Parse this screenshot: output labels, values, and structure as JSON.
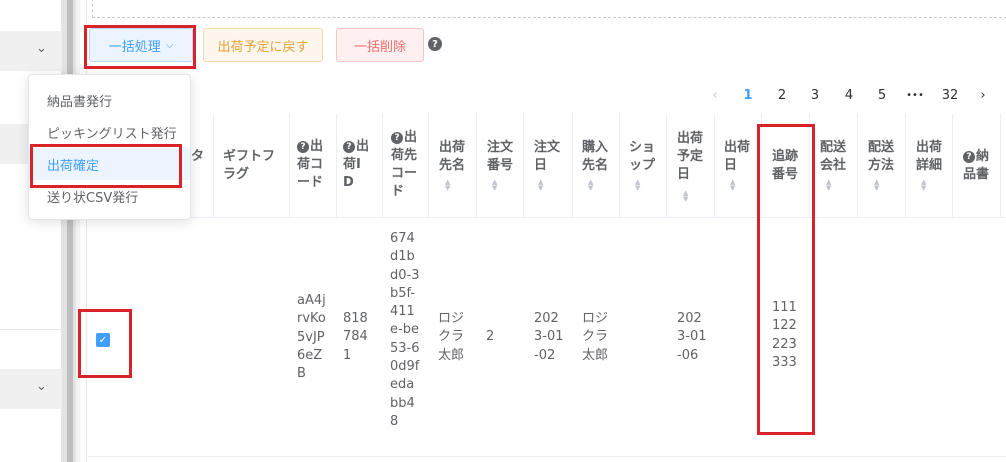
{
  "toolbar": {
    "bulk_label": "一括処理",
    "bulk_caret": "⌵",
    "return_label": "出荷予定に戻す",
    "delete_label": "一括削除",
    "help": "?"
  },
  "pagination": {
    "prev": "‹",
    "pages": [
      "1",
      "2",
      "3",
      "4",
      "5"
    ],
    "ellipsis": "•••",
    "last": "32",
    "next": "›",
    "current": "1"
  },
  "dropdown": {
    "items": [
      "納品書発行",
      "ピッキングリスト発行",
      "出荷確定",
      "送り状CSV発行"
    ],
    "highlighted": "出荷確定"
  },
  "sidebar": {
    "chevron": "⌄"
  },
  "table": {
    "headers": {
      "partial": "タ",
      "gift_flag": [
        "ギフトフ",
        "ラグ"
      ],
      "shipment_code": [
        "出",
        "荷コ",
        "ード"
      ],
      "shipment_id": [
        "出",
        "荷I",
        "D"
      ],
      "dest_code": [
        "出",
        "荷先",
        "コー",
        "ド"
      ],
      "dest_name": [
        "出荷",
        "先名"
      ],
      "order_no": [
        "注文",
        "番号"
      ],
      "order_date": [
        "注文",
        "日"
      ],
      "buyer_name": [
        "購入",
        "先名"
      ],
      "shop": [
        "ショ",
        "ップ"
      ],
      "planned_date": [
        "出荷",
        "予定",
        "日"
      ],
      "ship_date": [
        "出荷",
        "日"
      ],
      "tracking_no": [
        "追跡",
        "番号"
      ],
      "carrier": [
        "配送",
        "会社"
      ],
      "delivery_method": [
        "配送",
        "方法"
      ],
      "ship_detail": [
        "出荷",
        "詳細"
      ],
      "delivery_note": [
        "納",
        "品書"
      ]
    },
    "row": {
      "checked": true,
      "check_glyph": "✓",
      "shipment_code": [
        "aA4j",
        "rvKo",
        "5vJP",
        "6eZ",
        "B"
      ],
      "shipment_id": [
        "818",
        "784",
        "1"
      ],
      "dest_code": [
        "674",
        "d1b",
        "d0-3",
        "b5f-",
        "411",
        "e-be",
        "53-6",
        "0d9f",
        "eda",
        "bb4",
        "8"
      ],
      "dest_name": [
        "ロジ",
        "クラ",
        "太郎"
      ],
      "order_no": "2",
      "order_date": [
        "202",
        "3-01",
        "-02"
      ],
      "buyer_name": [
        "ロジ",
        "クラ",
        "太郎"
      ],
      "planned_date": [
        "202",
        "3-01",
        "-06"
      ],
      "tracking_no": [
        "111",
        "122",
        "223",
        "333"
      ]
    }
  },
  "colors": {
    "primary": "#409eff",
    "warning": "#e6a23c",
    "danger": "#f56c6c",
    "highlight_frame": "#d9222a"
  }
}
